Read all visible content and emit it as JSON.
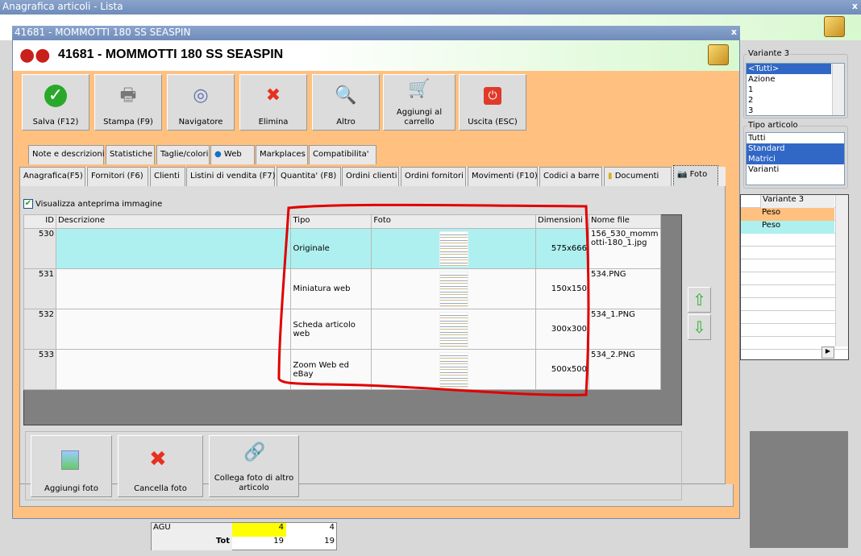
{
  "background_window": {
    "title": "Anagrafica articoli  - Lista",
    "close": "x",
    "variante3": {
      "label": "Variante 3",
      "items": [
        "<Tutti>",
        "Azione",
        "1",
        "2",
        "3"
      ],
      "selected": "<Tutti>"
    },
    "tipo_articolo": {
      "label": "Tipo articolo",
      "items": [
        "Tutti",
        "Standard",
        "Matrici",
        "Varianti"
      ],
      "selected": [
        "Standard",
        "Matrici"
      ]
    },
    "grid": {
      "header": "Variante 3",
      "rows": [
        "Peso",
        "Peso"
      ]
    },
    "totals": {
      "rows": [
        {
          "label": "AGU",
          "a": "4",
          "b": "4"
        },
        {
          "label": "Tot",
          "a": "19",
          "b": "19"
        }
      ]
    }
  },
  "dialog": {
    "title": "41681 - MOMMOTTI 180 SS SEASPIN",
    "close": "x",
    "header": "41681 - MOMMOTTI 180 SS SEASPIN",
    "toolbar": [
      {
        "label": "Salva (F12)",
        "icon": "check-icon"
      },
      {
        "label": "Stampa (F9)",
        "icon": "printer-icon"
      },
      {
        "label": "Navigatore",
        "icon": "compass-icon"
      },
      {
        "label": "Elimina",
        "icon": "delete-x-icon"
      },
      {
        "label": "Altro",
        "icon": "magnifier-icon"
      },
      {
        "label": "Aggiungi al carrello",
        "icon": "cart-icon"
      },
      {
        "label": "Uscita (ESC)",
        "icon": "power-icon"
      }
    ],
    "tabs_row1": [
      "Note e descrizioni",
      "Statistiche",
      "Taglie/colori",
      "Web",
      "Markplaces",
      "Compatibilita'"
    ],
    "tabs_row2": [
      "Anagrafica(F5)",
      "Fornitori (F6)",
      "Clienti",
      "Listini di vendita (F7)",
      "Quantita' (F8)",
      "Ordini clienti",
      "Ordini fornitori",
      "Movimenti (F10)",
      "Codici a barre",
      "Documenti",
      "Foto"
    ],
    "active_tab": "Foto",
    "preview_checkbox": {
      "label": "Visualizza anteprima immagine",
      "checked": true
    },
    "photo_table": {
      "columns": [
        "ID",
        "Descrizione",
        "Tipo",
        "Foto",
        "Dimensioni",
        "Nome file"
      ],
      "rows": [
        {
          "id": "530",
          "descrizione": "",
          "tipo": "Originale",
          "dimensioni": "575x666",
          "nome_file": "156_530_mommotti-180_1.jpg",
          "selected": true
        },
        {
          "id": "531",
          "descrizione": "",
          "tipo": "Miniatura web",
          "dimensioni": "150x150",
          "nome_file": "534.PNG"
        },
        {
          "id": "532",
          "descrizione": "",
          "tipo": "Scheda articolo web",
          "dimensioni": "300x300",
          "nome_file": "534_1.PNG"
        },
        {
          "id": "533",
          "descrizione": "",
          "tipo": "Zoom Web ed eBay",
          "dimensioni": "500x500",
          "nome_file": "534_2.PNG"
        }
      ]
    },
    "bottom_buttons": [
      {
        "label": "Aggiungi foto",
        "icon": "add-image-icon"
      },
      {
        "label": "Cancella foto",
        "icon": "delete-x-icon"
      },
      {
        "label": "Collega foto di altro articolo",
        "icon": "link-add-icon"
      }
    ]
  },
  "colors": {
    "accent_orange": "#ffc080",
    "selected_row": "#aef0f0",
    "annotation": "#e00000",
    "titlebar": "#7a96c0"
  }
}
